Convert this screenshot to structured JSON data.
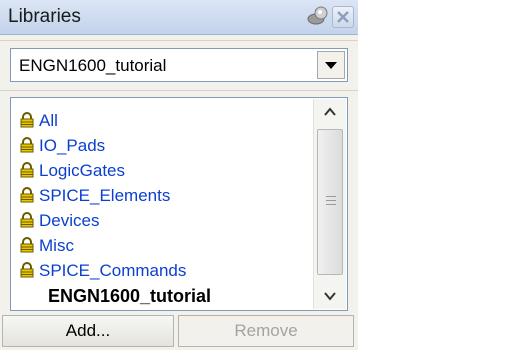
{
  "panel": {
    "title": "Libraries",
    "pin_icon": "pin-icon",
    "close_icon": "close-icon"
  },
  "library_select": {
    "value": "ENGN1600_tutorial",
    "dropdown_icon": "chevron-down-icon"
  },
  "libraries": {
    "items": [
      {
        "label": "All",
        "icon": "lock-icon"
      },
      {
        "label": "IO_Pads",
        "icon": "lock-icon"
      },
      {
        "label": "LogicGates",
        "icon": "lock-icon"
      },
      {
        "label": "SPICE_Elements",
        "icon": "lock-icon"
      },
      {
        "label": "Devices",
        "icon": "lock-icon"
      },
      {
        "label": "Misc",
        "icon": "lock-icon"
      },
      {
        "label": "SPICE_Commands",
        "icon": "lock-icon"
      },
      {
        "label": "ENGN1600_tutorial"
      }
    ]
  },
  "buttons": {
    "add_label": "Add...",
    "remove_label": "Remove"
  },
  "colors": {
    "link": "#0b3fd1",
    "titlebar": "#c3d3ec",
    "panel_bg": "#f2f1ec"
  }
}
